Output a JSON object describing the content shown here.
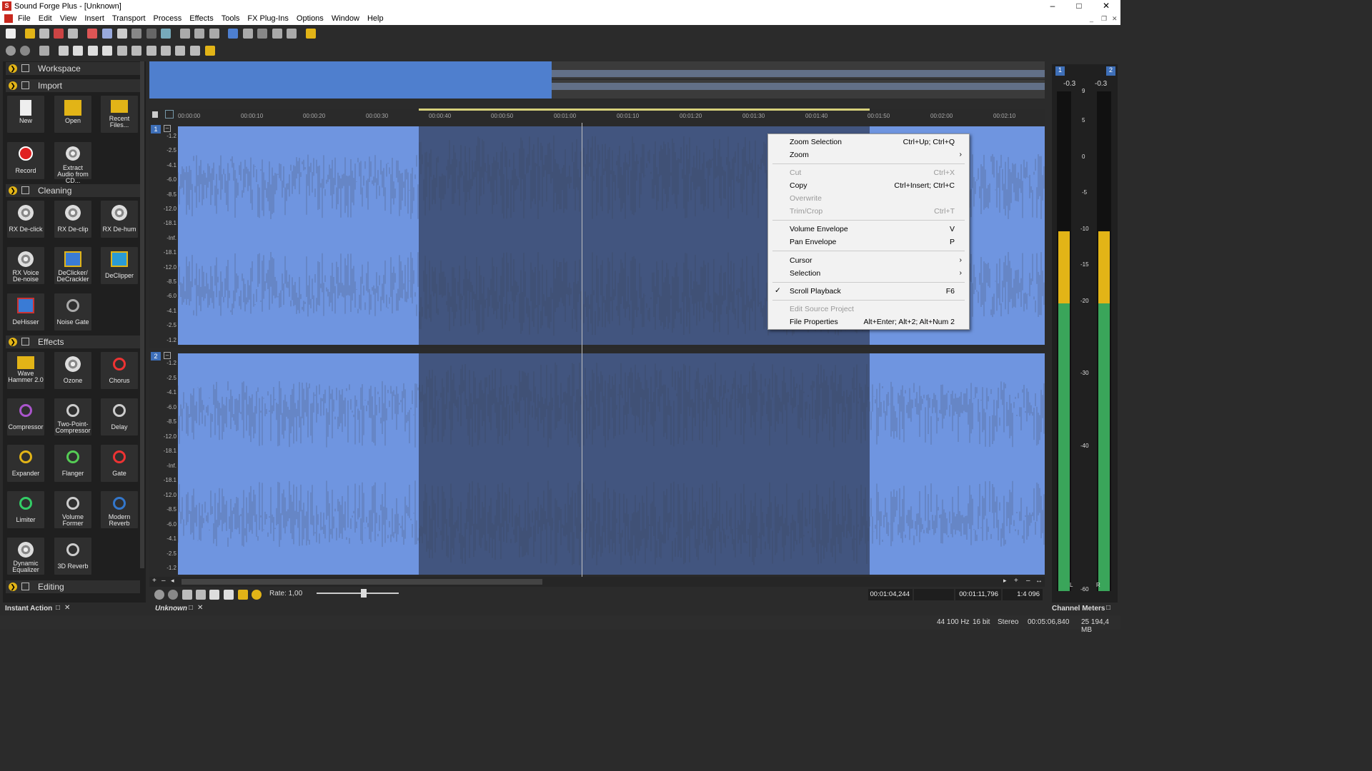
{
  "window": {
    "title": "Sound Forge Plus - [Unknown]",
    "minimize": "–",
    "maximize": "□",
    "close": "✕"
  },
  "menu": [
    "File",
    "Edit",
    "View",
    "Insert",
    "Transport",
    "Process",
    "Effects",
    "Tools",
    "FX Plug-Ins",
    "Options",
    "Window",
    "Help"
  ],
  "workspace": {
    "sections": [
      {
        "key": "workspace",
        "label": "Workspace"
      },
      {
        "key": "import",
        "label": "Import"
      },
      {
        "key": "cleaning",
        "label": "Cleaning"
      },
      {
        "key": "effects",
        "label": "Effects"
      },
      {
        "key": "editing",
        "label": "Editing"
      }
    ],
    "import_tiles": [
      "New",
      "Open",
      "Recent Files...",
      "Record",
      "Extract Audio from CD..."
    ],
    "cleaning_tiles": [
      "RX De-click",
      "RX De-clip",
      "RX De-hum",
      "RX Voice De-noise",
      "DeClicker/ DeCrackler",
      "DeClipper",
      "DeHisser",
      "Noise Gate"
    ],
    "effects_tiles": [
      "Wave Hammer 2.0",
      "Ozone",
      "Chorus",
      "Compressor",
      "Two-Point-Compressor",
      "Delay",
      "Expander",
      "Flanger",
      "Gate",
      "Limiter",
      "Volume Former",
      "Modern Reverb",
      "Dynamic Equalizer",
      "3D Reverb"
    ]
  },
  "ruler": {
    "ticks": [
      "00:00:00",
      "00:00:10",
      "00:00:20",
      "00:00:30",
      "00:00:40",
      "00:00:50",
      "00:01:00",
      "00:01:10",
      "00:01:20",
      "00:01:30",
      "00:01:40",
      "00:01:50",
      "00:02:00",
      "00:02:10"
    ]
  },
  "channels": [
    {
      "number": "1",
      "db_labels": [
        "-1.2",
        "-2.5",
        "-4.1",
        "-6.0",
        "-8.5",
        "-12.0",
        "-18.1",
        "-Inf.",
        "-18.1",
        "-12.0",
        "-8.5",
        "-6.0",
        "-4.1",
        "-2.5",
        "-1.2"
      ]
    },
    {
      "number": "2",
      "db_labels": [
        "-1.2",
        "-2.5",
        "-4.1",
        "-6.0",
        "-8.5",
        "-12.0",
        "-18.1",
        "-Inf.",
        "-18.1",
        "-12.0",
        "-8.5",
        "-6.0",
        "-4.1",
        "-2.5",
        "-1.2"
      ]
    }
  ],
  "context_menu": {
    "items": [
      {
        "label": "Zoom Selection",
        "shortcut": "Ctrl+Up; Ctrl+Q",
        "disabled": false
      },
      {
        "label": "Zoom",
        "submenu": true,
        "disabled": false
      },
      {
        "label": "Cut",
        "shortcut": "Ctrl+X",
        "disabled": true
      },
      {
        "label": "Copy",
        "shortcut": "Ctrl+Insert; Ctrl+C",
        "disabled": false
      },
      {
        "label": "Overwrite",
        "disabled": true
      },
      {
        "label": "Trim/Crop",
        "shortcut": "Ctrl+T",
        "disabled": true
      },
      {
        "label": "Volume Envelope",
        "shortcut": "V",
        "disabled": false
      },
      {
        "label": "Pan Envelope",
        "shortcut": "P",
        "disabled": false
      },
      {
        "label": "Cursor",
        "submenu": true,
        "disabled": false
      },
      {
        "label": "Selection",
        "submenu": true,
        "disabled": false
      },
      {
        "label": "Scroll Playback",
        "shortcut": "F6",
        "checked": true,
        "disabled": false
      },
      {
        "label": "Edit Source Project",
        "disabled": true
      },
      {
        "label": "File Properties",
        "shortcut": "Alt+Enter; Alt+2; Alt+Num 2",
        "disabled": false
      }
    ]
  },
  "transport": {
    "rate_label": "Rate: 1,00",
    "selection_start": "00:01:04,244",
    "selection_end": "00:01:11,796",
    "zoom_ratio": "1:4 096"
  },
  "meters": {
    "channel_a": "1",
    "channel_b": "2",
    "peak_l": "-0.3",
    "peak_r": "-0.3",
    "scale": [
      "9",
      "5",
      "0",
      "-5",
      "-10",
      "-15",
      "-20",
      "-30",
      "-40",
      "-60"
    ],
    "label_l": "L",
    "label_r": "R",
    "level_l": 0.72,
    "level_r": 0.72
  },
  "tabs": {
    "instant_action": "Instant Action",
    "doc": "Unknown",
    "channel_meters": "Channel Meters"
  },
  "status": {
    "sample_rate": "44 100 Hz",
    "bit_depth": "16 bit",
    "channels": "Stereo",
    "length": "00:05:06,840",
    "size": "25 194,4 MB"
  },
  "colors": {
    "wave": "#6f95e0",
    "selection": "#42557f",
    "accent": "#e2b417"
  }
}
